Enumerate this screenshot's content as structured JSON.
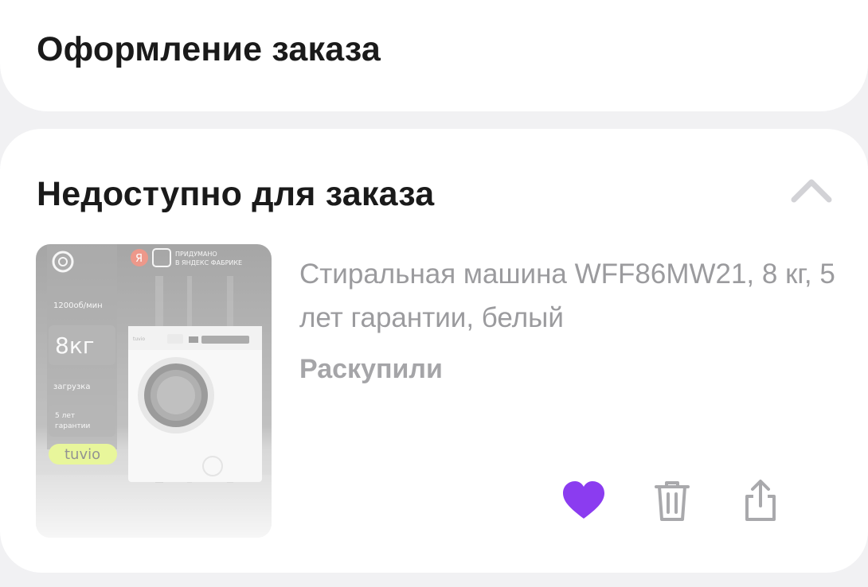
{
  "header": {
    "title": "Оформление заказа"
  },
  "unavailable_section": {
    "title": "Недоступно для заказа",
    "toggle_icon": "chevron-up-icon",
    "item": {
      "name": "Стиральная машина WFF86MW21, 8 кг, 5 лет гарантии, белый",
      "status": "Раскупили",
      "image": {
        "badge_text_line1": "ПРИДУМАНО",
        "badge_text_line2": "В ЯНДЕКС ФАБРИКЕ",
        "badge_letter": "Я",
        "spec_speed": "1200об/мин",
        "spec_load_value": "8кг",
        "spec_load_label": "загрузка",
        "spec_warranty_line1": "5 лет",
        "spec_warranty_line2": "гарантии",
        "brand": "tuvio",
        "machine_brand": "tuvio"
      },
      "actions": {
        "favorite_icon": "heart-icon",
        "delete_icon": "trash-icon",
        "share_icon": "share-icon"
      }
    }
  },
  "colors": {
    "background": "#f1f1f3",
    "card": "#ffffff",
    "title": "#1a1a1a",
    "muted_text": "#9b9b9e",
    "favorite": "#8b3cf0",
    "icon_gray": "#a9a9ac",
    "brand_badge": "#d7f04a"
  }
}
